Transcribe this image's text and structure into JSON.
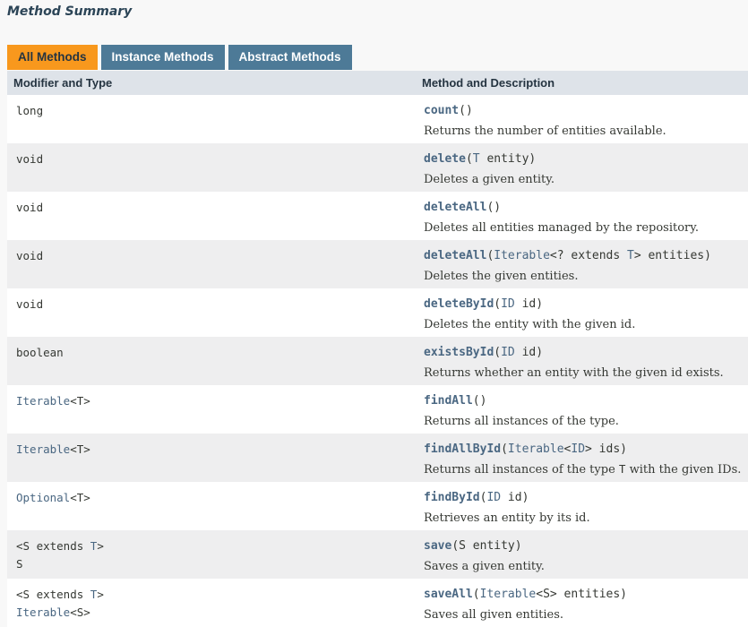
{
  "heading": "Method Summary",
  "tabs": [
    "All Methods",
    "Instance Methods",
    "Abstract Methods"
  ],
  "columns": {
    "modifier": "Modifier and Type",
    "method": "Method and Description"
  },
  "rows": [
    {
      "type_a": "long",
      "type_link": "",
      "type_b": "",
      "type_line2": "",
      "type_line2_link": "",
      "type_line2_b": "",
      "name": "count",
      "params_a": "()",
      "param_link": "",
      "params_b": "",
      "param_link2": "",
      "params_c": "",
      "desc_a": "Returns the number of entities available.",
      "desc_code": "",
      "desc_b": ""
    },
    {
      "type_a": "void",
      "type_link": "",
      "type_b": "",
      "type_line2": "",
      "type_line2_link": "",
      "type_line2_b": "",
      "name": "delete",
      "params_a": "(",
      "param_link": "T",
      "params_b": " entity)",
      "param_link2": "",
      "params_c": "",
      "desc_a": "Deletes a given entity.",
      "desc_code": "",
      "desc_b": ""
    },
    {
      "type_a": "void",
      "type_link": "",
      "type_b": "",
      "type_line2": "",
      "type_line2_link": "",
      "type_line2_b": "",
      "name": "deleteAll",
      "params_a": "()",
      "param_link": "",
      "params_b": "",
      "param_link2": "",
      "params_c": "",
      "desc_a": "Deletes all entities managed by the repository.",
      "desc_code": "",
      "desc_b": ""
    },
    {
      "type_a": "void",
      "type_link": "",
      "type_b": "",
      "type_line2": "",
      "type_line2_link": "",
      "type_line2_b": "",
      "name": "deleteAll",
      "params_a": "(",
      "param_link": "Iterable",
      "params_b": "<? extends ",
      "param_link2": "T",
      "params_c": "> entities)",
      "desc_a": "Deletes the given entities.",
      "desc_code": "",
      "desc_b": ""
    },
    {
      "type_a": "void",
      "type_link": "",
      "type_b": "",
      "type_line2": "",
      "type_line2_link": "",
      "type_line2_b": "",
      "name": "deleteById",
      "params_a": "(",
      "param_link": "ID",
      "params_b": " id)",
      "param_link2": "",
      "params_c": "",
      "desc_a": "Deletes the entity with the given id.",
      "desc_code": "",
      "desc_b": ""
    },
    {
      "type_a": "boolean",
      "type_link": "",
      "type_b": "",
      "type_line2": "",
      "type_line2_link": "",
      "type_line2_b": "",
      "name": "existsById",
      "params_a": "(",
      "param_link": "ID",
      "params_b": " id)",
      "param_link2": "",
      "params_c": "",
      "desc_a": "Returns whether an entity with the given id exists.",
      "desc_code": "",
      "desc_b": ""
    },
    {
      "type_a": "",
      "type_link": "Iterable",
      "type_b": "<T>",
      "type_line2": "",
      "type_line2_link": "",
      "type_line2_b": "",
      "name": "findAll",
      "params_a": "()",
      "param_link": "",
      "params_b": "",
      "param_link2": "",
      "params_c": "",
      "desc_a": "Returns all instances of the type.",
      "desc_code": "",
      "desc_b": ""
    },
    {
      "type_a": "",
      "type_link": "Iterable",
      "type_b": "<T>",
      "type_line2": "",
      "type_line2_link": "",
      "type_line2_b": "",
      "name": "findAllById",
      "params_a": "(",
      "param_link": "Iterable",
      "params_b": "<",
      "param_link2": "ID",
      "params_c": "> ids)",
      "desc_a": "Returns all instances of the type ",
      "desc_code": "T",
      "desc_b": " with the given IDs."
    },
    {
      "type_a": "",
      "type_link": "Optional",
      "type_b": "<T>",
      "type_line2": "",
      "type_line2_link": "",
      "type_line2_b": "",
      "name": "findById",
      "params_a": "(",
      "param_link": "ID",
      "params_b": " id)",
      "param_link2": "",
      "params_c": "",
      "desc_a": "Retrieves an entity by its id.",
      "desc_code": "",
      "desc_b": ""
    },
    {
      "type_a": "<S extends ",
      "type_link": "T",
      "type_b": ">",
      "type_line2": "S",
      "type_line2_link": "",
      "type_line2_b": "",
      "name": "save",
      "params_a": "(S entity)",
      "param_link": "",
      "params_b": "",
      "param_link2": "",
      "params_c": "",
      "desc_a": "Saves a given entity.",
      "desc_code": "",
      "desc_b": ""
    },
    {
      "type_a": "<S extends ",
      "type_link": "T",
      "type_b": ">",
      "type_line2": "",
      "type_line2_link": "Iterable",
      "type_line2_b": "<S>",
      "name": "saveAll",
      "params_a": "(",
      "param_link": "Iterable",
      "params_b": "<S> entities)",
      "param_link2": "",
      "params_c": "",
      "desc_a": "Saves all given entities.",
      "desc_code": "",
      "desc_b": ""
    }
  ]
}
